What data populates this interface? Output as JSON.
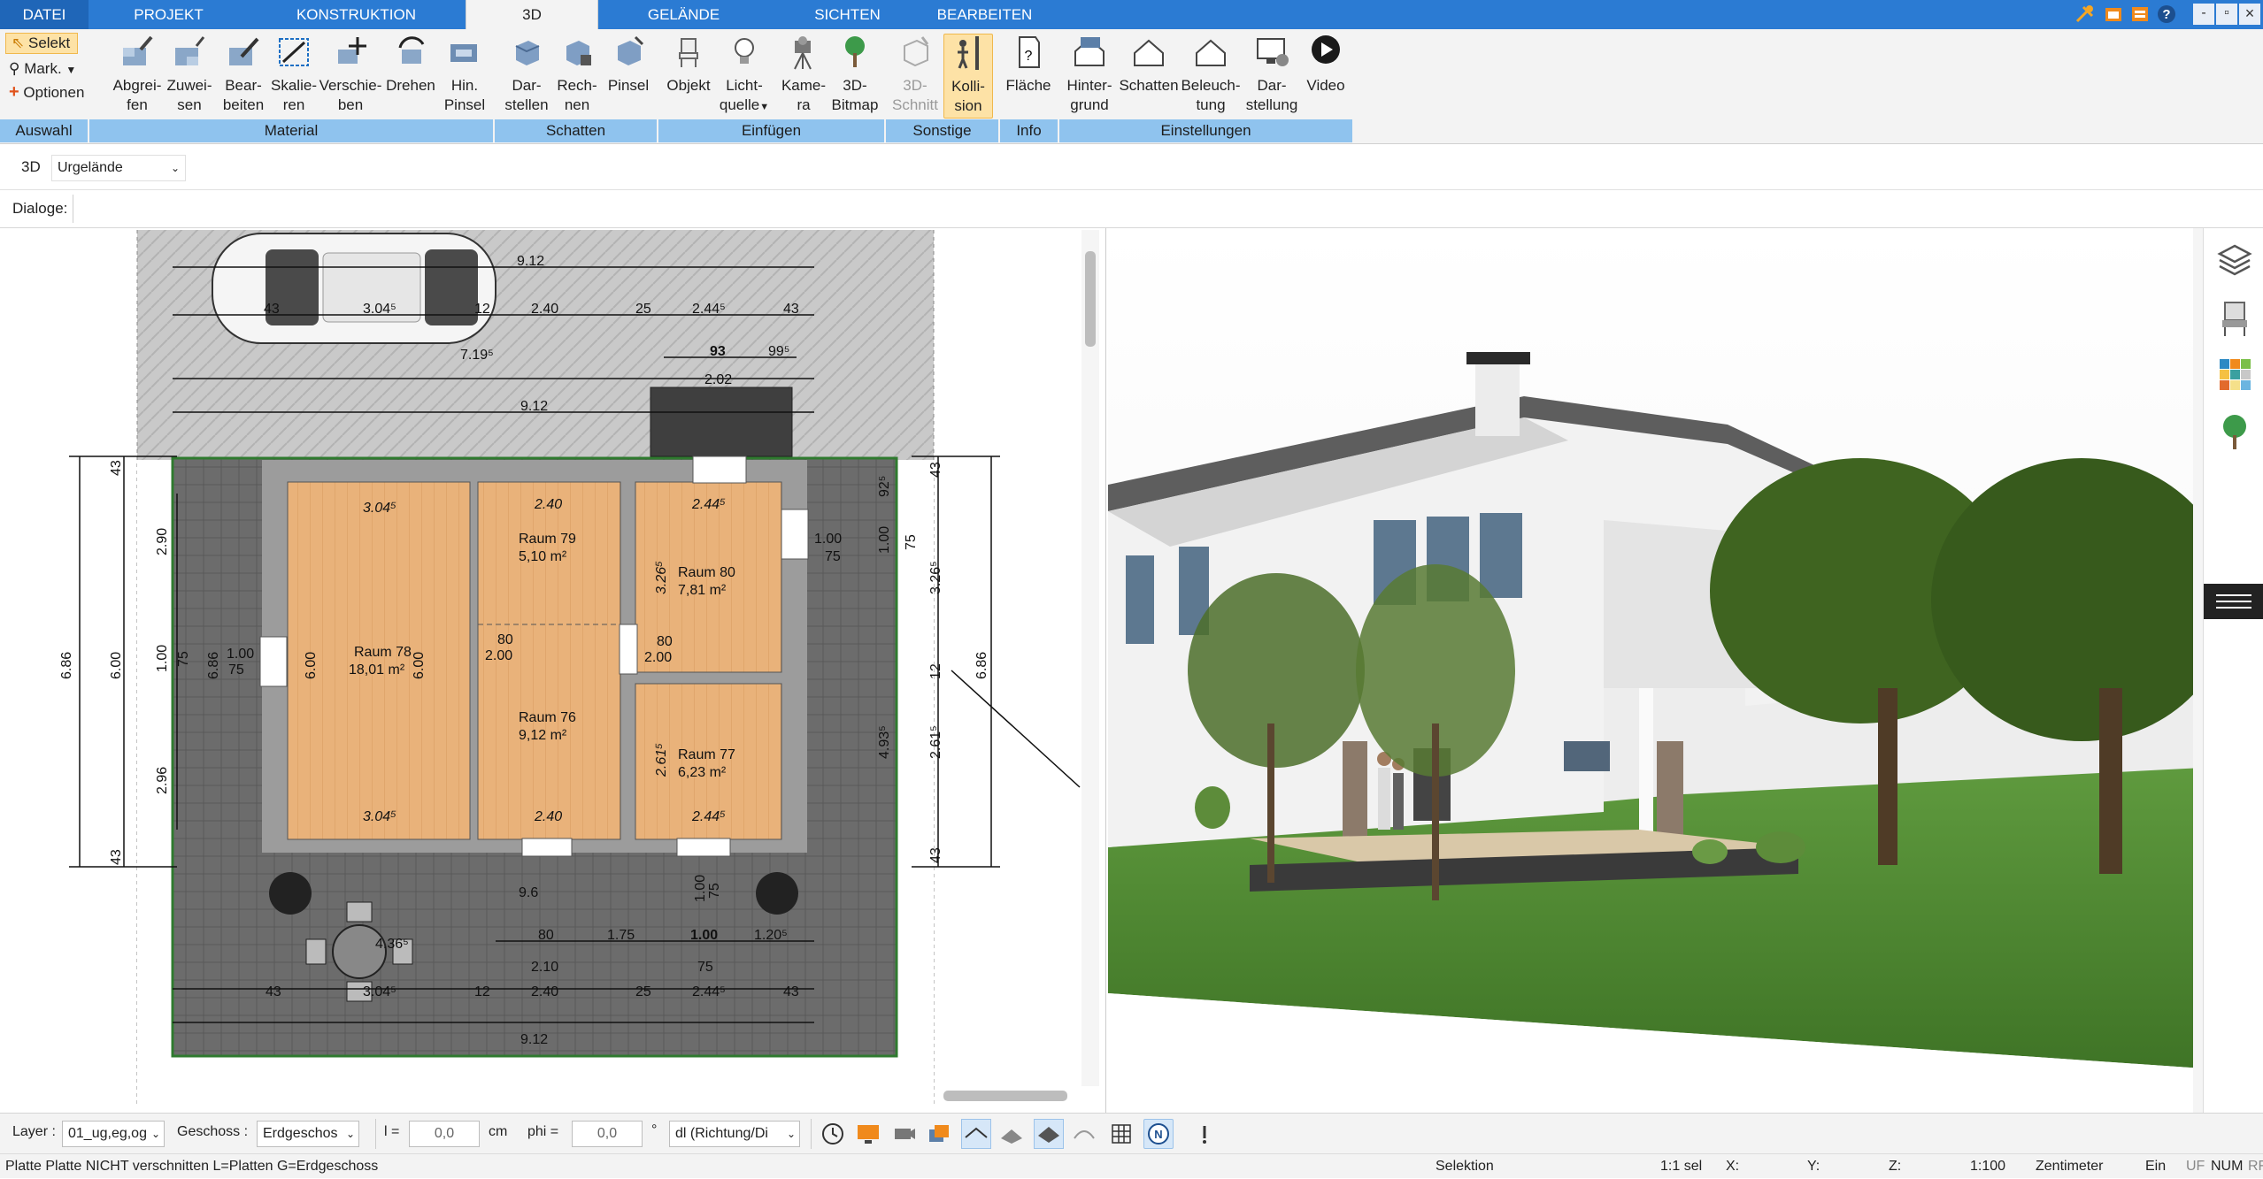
{
  "menubar": {
    "tabs": [
      {
        "label": "DATEI",
        "active": false
      },
      {
        "label": "PROJEKT",
        "active": false
      },
      {
        "label": "KONSTRUKTION",
        "active": false
      },
      {
        "label": "3D",
        "active": true
      },
      {
        "label": "GELÄNDE",
        "active": false
      },
      {
        "label": "SICHTEN",
        "active": false
      },
      {
        "label": "BEARBEITEN",
        "active": false
      }
    ],
    "window_controls": {
      "minimize": "-",
      "restore": "▫",
      "close": "×"
    }
  },
  "ribbon": {
    "auswahl": {
      "selekt": "Selekt",
      "mark": "Mark.",
      "optionen": "Optionen"
    },
    "buttons": [
      {
        "line1": "Abgrei-",
        "line2": "fen",
        "icon": "pipette-icon"
      },
      {
        "line1": "Zuwei-",
        "line2": "sen",
        "icon": "assign-material-icon"
      },
      {
        "line1": "Bear-",
        "line2": "beiten",
        "icon": "edit-material-icon"
      },
      {
        "line1": "Skalie-",
        "line2": "ren",
        "icon": "scale-icon"
      },
      {
        "line1": "Verschie-",
        "line2": "ben",
        "icon": "move-icon"
      },
      {
        "line1": "Drehen",
        "line2": "",
        "icon": "rotate-icon"
      },
      {
        "line1": "Hin.",
        "line2": "Pinsel",
        "icon": "brush-icon"
      },
      {
        "line1": "Dar-",
        "line2": "stellen",
        "icon": "shadow-display-icon"
      },
      {
        "line1": "Rech-",
        "line2": "nen",
        "icon": "shadow-calc-icon"
      },
      {
        "line1": "Pinsel",
        "line2": "",
        "icon": "shadow-brush-icon"
      },
      {
        "line1": "Objekt",
        "line2": "",
        "icon": "chair-icon"
      },
      {
        "line1": "Licht-",
        "line2": "quelle",
        "icon": "bulb-icon"
      },
      {
        "line1": "Kame-",
        "line2": "ra",
        "icon": "camera-icon"
      },
      {
        "line1": "3D-",
        "line2": "Bitmap",
        "icon": "tree-icon"
      },
      {
        "line1": "3D-",
        "line2": "Schnitt",
        "icon": "section-icon"
      },
      {
        "line1": "Kolli-",
        "line2": "sion",
        "icon": "collision-icon"
      },
      {
        "line1": "Fläche",
        "line2": "",
        "icon": "area-icon"
      },
      {
        "line1": "Hinter-",
        "line2": "grund",
        "icon": "background-icon"
      },
      {
        "line1": "Schatten",
        "line2": "",
        "icon": "house-shadow-icon"
      },
      {
        "line1": "Beleuch-",
        "line2": "tung",
        "icon": "lighting-icon"
      },
      {
        "line1": "Dar-",
        "line2": "stellung",
        "icon": "display-settings-icon"
      },
      {
        "line1": "Video",
        "line2": "",
        "icon": "video-icon"
      }
    ],
    "groups": [
      "Auswahl",
      "Material",
      "Schatten",
      "Einfügen",
      "Sonstige",
      "Info",
      "Einstellungen"
    ]
  },
  "toolbar": {
    "mode": "3D",
    "layer_select": "Urgelände",
    "dialoge_label": "Dialoge:"
  },
  "plan": {
    "dims_top": [
      "9.12",
      "43",
      "3.04⁵",
      "12",
      "2.40",
      "25",
      "2.44⁵",
      "43",
      "7.19⁵",
      "93",
      "99⁵",
      "2.02",
      "9.12"
    ],
    "rooms": [
      {
        "name": "Raum 78",
        "area": "18,01 m²"
      },
      {
        "name": "Raum 79",
        "area": "5,10 m²"
      },
      {
        "name": "Raum 80",
        "area": "7,81 m²"
      },
      {
        "name": "Raum 76",
        "area": "9,12 m²"
      },
      {
        "name": "Raum 77",
        "area": "6,23 m²"
      }
    ],
    "room_dims": [
      "3.04⁵",
      "2.40",
      "2.44⁵",
      "3.04⁵",
      "2.40",
      "2.44⁵",
      "6.00",
      "6.00",
      "80",
      "2.00",
      "80",
      "2.00",
      "3.26⁵",
      "2.61⁵",
      "1.00",
      "75"
    ],
    "dims_left": [
      "43",
      "2.90",
      "6.86",
      "6.00",
      "1.00",
      "75",
      "6.86",
      "1.00",
      "75",
      "2.96",
      "43"
    ],
    "dims_right": [
      "43",
      "92⁵",
      "1.00",
      "75",
      "3.26⁵",
      "12",
      "6.86",
      "4.93⁵",
      "2.61⁵",
      "43",
      "1.00",
      "75"
    ],
    "dims_bottom": [
      "9.6",
      "80",
      "2.10",
      "1.75",
      "1.00",
      "75",
      "1.20⁵",
      "4.36⁵",
      "43",
      "3.04⁵",
      "12",
      "2.40",
      "25",
      "2.44⁵",
      "43",
      "9.12"
    ]
  },
  "bottombar": {
    "layer_label": "Layer :",
    "layer_value": "01_ug,eg,og",
    "geschoss_label": "Geschoss :",
    "geschoss_value": "Erdgeschos",
    "l_label": "l =",
    "l_value": "0,0",
    "l_unit": "cm",
    "phi_label": "phi =",
    "phi_value": "0,0",
    "phi_unit": "°",
    "direction_value": "dl (Richtung/Di"
  },
  "status": {
    "message": "Platte Platte NICHT verschnitten L=Platten G=Erdgeschoss",
    "mode": "Selektion",
    "scale_sel": "1:1 sel",
    "x": "X:",
    "y": "Y:",
    "z": "Z:",
    "scale": "1:100",
    "unit": "Zentimeter",
    "ein": "Ein",
    "uf": "UF",
    "num": "NUM",
    "rf": "RF"
  },
  "colors": {
    "accent": "#2b7bd3",
    "group_bar": "#8fc3ee",
    "selected": "#fde2a6",
    "floor": "#e9b27a",
    "paving": "#6c6c6c",
    "lawn": "#4f8a34"
  }
}
